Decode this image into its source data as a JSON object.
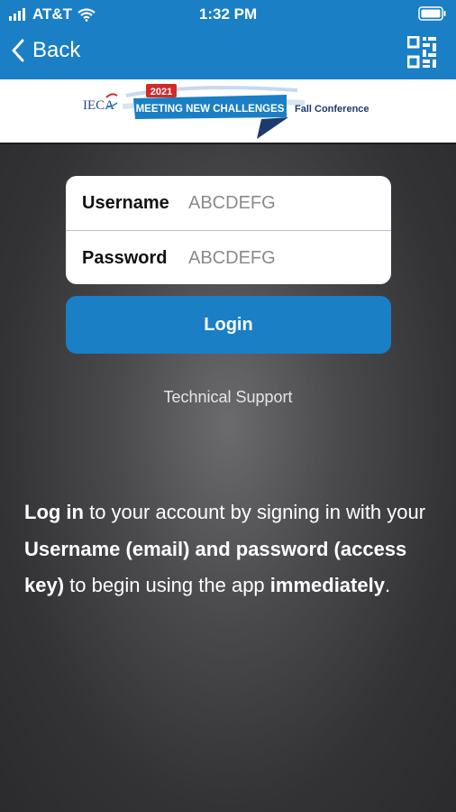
{
  "status_bar": {
    "carrier": "AT&T",
    "time": "1:32 PM"
  },
  "navbar": {
    "back_label": "Back"
  },
  "banner": {
    "org": "IECA",
    "year": "2021",
    "headline": "MEETING NEW CHALLENGES",
    "subtitle": "Fall Conference"
  },
  "form": {
    "username_label": "Username",
    "username_value": "ABCDEFG",
    "password_label": "Password",
    "password_value": "ABCDEFG",
    "login_label": "Login"
  },
  "links": {
    "technical_support": "Technical Support"
  },
  "description": {
    "part1_bold": "Log in",
    "part2": " to your account by signing in with your ",
    "part3_bold": "Username (email) and password (access key)",
    "part4": " to begin using the app ",
    "part5_bold": "immediately",
    "part6": "."
  },
  "colors": {
    "accent": "#1a7fc4",
    "brand_red": "#d12a2a"
  }
}
